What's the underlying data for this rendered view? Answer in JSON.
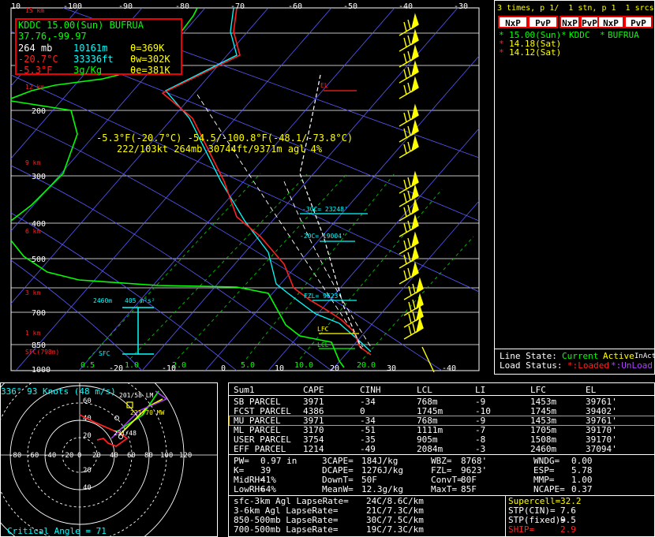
{
  "colors": {
    "grid": "#ffffff",
    "isotherm": "#5a5aff",
    "temp": "#ff2020",
    "dew": "#00ff00",
    "virtual": "#00ffff",
    "wind": "#ffff00",
    "mixing": "#00c000"
  },
  "skewt": {
    "temp_ticks": [
      "10",
      "-100",
      "-90",
      "-80",
      "-70",
      "-60",
      "-50",
      "-40",
      "-30"
    ],
    "pressure_labels": [
      "200",
      "300",
      "400",
      "500",
      "700",
      "850",
      "1000"
    ],
    "height_labels": [
      "15 km",
      "12 km",
      "9 km",
      "6 km",
      "3 km",
      "1 km"
    ],
    "sfc_label": "SFC(798m)",
    "bottom_ticks": [
      "0.5",
      "-20",
      "1.0",
      "-10",
      "2.0",
      "0",
      "5.0",
      "10",
      "10.0",
      "20",
      "20.0",
      "30",
      "-40"
    ],
    "levels": {
      "el": "EL",
      "c30": "-30C= 23248'",
      "c20": "-20C= 19004'",
      "fzl": "FZL= 9623'",
      "lfc": "LFC",
      "lcl": "LCL"
    },
    "effective_inflow": {
      "top": "2460m",
      "srh": "405 m²s²",
      "sfc": "SFC"
    },
    "cursor": {
      "line1": "-5.3°F(-20.7°C) -54.5/-100.8°F(-48.1/-73.8°C)",
      "line2": "222/103kt  264mb  30744ft/9371m agl   4%"
    },
    "infobox": {
      "station": "KDDC 15.00(Sun) BUFRUA",
      "coords": "37.76,-99.97",
      "pres": "264 mb",
      "hgt": "10161m",
      "theta": "θ=369K",
      "tc": "-20.7°C",
      "ft": "33336ft",
      "thetaw": "θw=302K",
      "tf": "-5.3°F",
      "mr": "3g/Kg",
      "thetae": "θe=381K"
    }
  },
  "side": {
    "header": "3 times, p 1/  1 stn, p 1  1 srcs, p 1/",
    "buttons": [
      "NxP",
      "PvP",
      "NxP",
      "PvP",
      "NxP",
      "PvP"
    ],
    "times": [
      "15.00(Sun)",
      "14.18(Sat)",
      "14.12(Sat)"
    ],
    "station": "KDDC",
    "source": "BUFRUA",
    "line_state_label": "Line State:",
    "current": "Current",
    "active": "Active",
    "inactive": "InActive",
    "load_status_label": "Load Status:",
    "loaded": "*:Loaded",
    "unload": "*:UnLoad"
  },
  "hodo": {
    "header": "336°  93 Knots (48 m/s)",
    "x_labels": [
      "-80",
      "-60",
      "-40",
      "-20",
      "0",
      "20",
      "40",
      "60",
      "80",
      "100",
      "120"
    ],
    "y_labels": [
      "60",
      "40",
      "20",
      "20",
      "40"
    ],
    "storm_motion": [
      "201/58 LM",
      "221/70 MW",
      "231/48"
    ],
    "critical_angle": "Critical Angle = 71"
  },
  "table": {
    "headers": [
      "Sum1",
      "CAPE",
      "CINH",
      "LCL",
      "LI",
      "LFC",
      "EL"
    ],
    "rows": [
      [
        "SB PARCEL",
        "3971",
        "-34",
        "768m",
        "-9",
        "1453m",
        "39761'"
      ],
      [
        "FCST PARCEL",
        "4386",
        "0",
        "1745m",
        "-10",
        "1745m",
        "39402'"
      ],
      [
        "MU PARCEL",
        "3971",
        "-34",
        "768m",
        "-9",
        "1453m",
        "39761'"
      ],
      [
        "ML PARCEL",
        "3170",
        "-51",
        "1111m",
        "-7",
        "1705m",
        "39170'"
      ],
      [
        "USER PARCEL",
        "3754",
        "-35",
        "905m",
        "-8",
        "1508m",
        "39170'"
      ],
      [
        "EFF PARCEL",
        "1214",
        "-49",
        "2084m",
        "-3",
        "2460m",
        "37094'"
      ]
    ],
    "params": [
      [
        "PW=",
        "0.97 in",
        "3CAPE=",
        "184J/kg",
        "WBZ=",
        "8768'",
        "WNDG=",
        "0.00"
      ],
      [
        "K=",
        "39",
        "DCAPE=",
        "1276J/kg",
        "FZL=",
        "9623'",
        "ESP=",
        "5.78"
      ],
      [
        "MidRH=",
        "41%",
        "DownT=",
        "50F",
        "ConvT=",
        "80F",
        "MMP=",
        "1.00"
      ],
      [
        "LowRH=",
        "64%",
        "MeanW=",
        "12.3g/kg",
        "MaxT=",
        "85F",
        "NCAPE=",
        "0.37"
      ]
    ],
    "lapse": [
      [
        "sfc-3km Agl LapseRate=",
        "24C/8.6C/km"
      ],
      [
        "3-6km Agl LapseRate=",
        "21C/7.3C/km"
      ],
      [
        "850-500mb LapseRate=",
        "30C/7.5C/km"
      ],
      [
        "700-500mb LapseRate=",
        "19C/7.3C/km"
      ]
    ],
    "composites": [
      [
        "Supercell=",
        "32.2"
      ],
      [
        "STP(CIN)=",
        "7.6"
      ],
      [
        "STP(fixed)=",
        "9.5"
      ],
      [
        "SHIP=",
        "2.9"
      ]
    ]
  }
}
